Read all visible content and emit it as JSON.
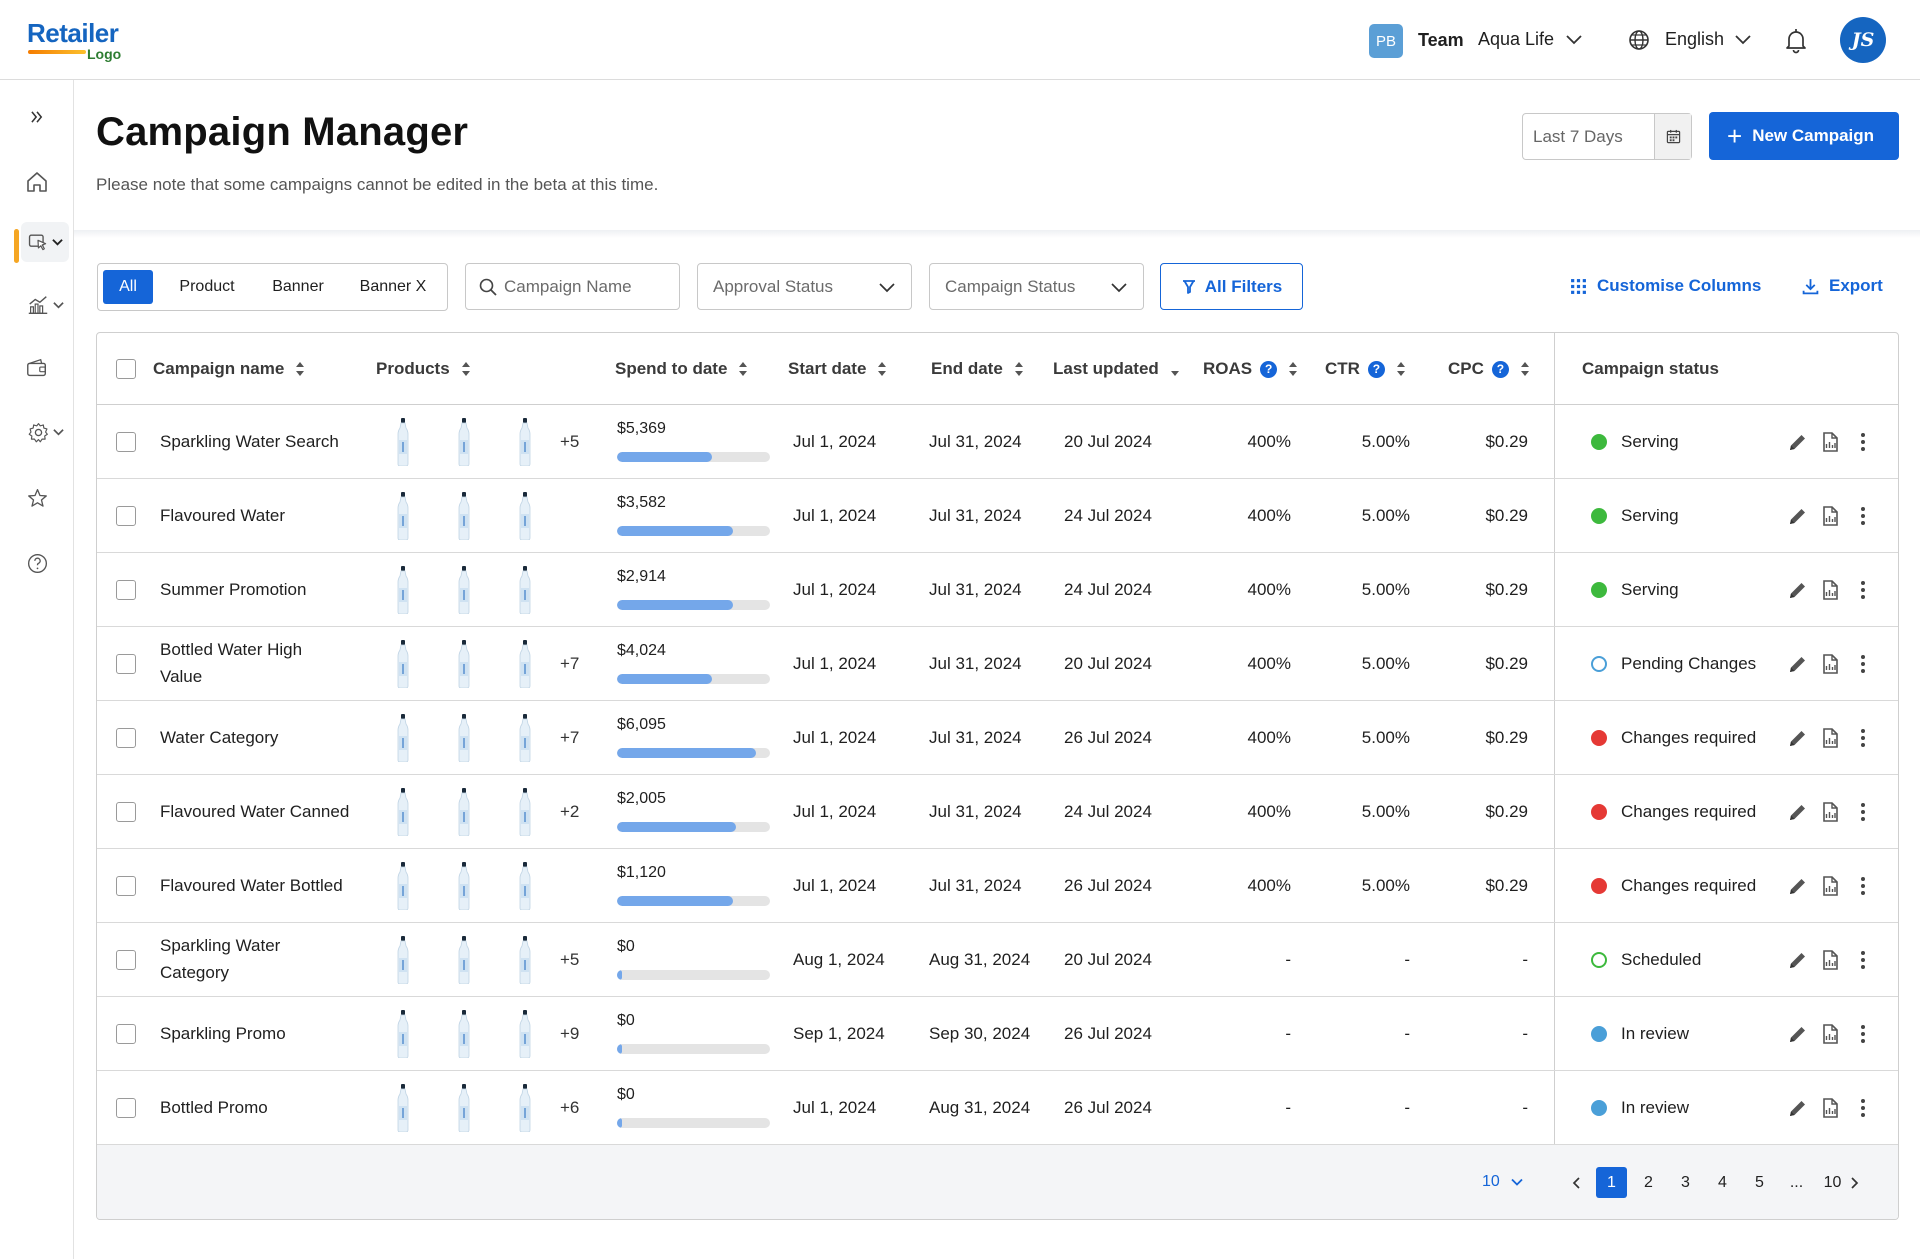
{
  "header": {
    "logo_top": "Retailer",
    "logo_bottom": "Logo",
    "team_initials": "PB",
    "team_label": "Team",
    "team_name": "Aqua Life",
    "language": "English",
    "user_initials": "JS"
  },
  "page": {
    "title": "Campaign Manager",
    "note": "Please note that some campaigns cannot be edited in the beta at this time.",
    "date_range": "Last 7 Days",
    "new_campaign": "New Campaign"
  },
  "filters": {
    "types": [
      "All",
      "Product",
      "Banner",
      "Banner X"
    ],
    "active_type": "All",
    "search_placeholder": "Campaign Name",
    "approval_status": "Approval Status",
    "campaign_status": "Campaign Status",
    "all_filters": "All Filters",
    "customise_columns": "Customise Columns",
    "export": "Export"
  },
  "columns": {
    "name": "Campaign name",
    "products": "Products",
    "spend": "Spend to date",
    "start": "Start date",
    "end": "End date",
    "updated": "Last updated",
    "roas": "ROAS",
    "ctr": "CTR",
    "cpc": "CPC",
    "status": "Campaign status"
  },
  "status_colors": {
    "serving": "#3db93d",
    "pending": "#4a9fd8",
    "changes": "#e53935",
    "scheduled": "#3db93d",
    "review": "#4a9fd8"
  },
  "rows": [
    {
      "name": "Sparkling Water Search",
      "more": "+5",
      "spend": "$5,369",
      "spend_pct": 0.62,
      "start": "Jul 1, 2024",
      "end": "Jul 31, 2024",
      "updated": "20 Jul 2024",
      "roas": "400%",
      "ctr": "5.00%",
      "cpc": "$0.29",
      "status": "Serving",
      "status_kind": "serving"
    },
    {
      "name": "Flavoured Water",
      "more": "",
      "spend": "$3,582",
      "spend_pct": 0.76,
      "start": "Jul 1, 2024",
      "end": "Jul 31, 2024",
      "updated": "24 Jul 2024",
      "roas": "400%",
      "ctr": "5.00%",
      "cpc": "$0.29",
      "status": "Serving",
      "status_kind": "serving"
    },
    {
      "name": "Summer Promotion",
      "more": "",
      "spend": "$2,914",
      "spend_pct": 0.76,
      "start": "Jul 1, 2024",
      "end": "Jul 31, 2024",
      "updated": "24 Jul 2024",
      "roas": "400%",
      "ctr": "5.00%",
      "cpc": "$0.29",
      "status": "Serving",
      "status_kind": "serving"
    },
    {
      "name": "Bottled Water High Value",
      "more": "+7",
      "spend": "$4,024",
      "spend_pct": 0.62,
      "start": "Jul 1, 2024",
      "end": "Jul 31, 2024",
      "updated": "20 Jul 2024",
      "roas": "400%",
      "ctr": "5.00%",
      "cpc": "$0.29",
      "status": "Pending Changes",
      "status_kind": "pending"
    },
    {
      "name": "Water Category",
      "more": "+7",
      "spend": "$6,095",
      "spend_pct": 0.91,
      "start": "Jul 1, 2024",
      "end": "Jul 31, 2024",
      "updated": "26 Jul 2024",
      "roas": "400%",
      "ctr": "5.00%",
      "cpc": "$0.29",
      "status": "Changes required",
      "status_kind": "changes"
    },
    {
      "name": "Flavoured Water Canned",
      "more": "+2",
      "spend": "$2,005",
      "spend_pct": 0.78,
      "start": "Jul 1, 2024",
      "end": "Jul 31, 2024",
      "updated": "24 Jul 2024",
      "roas": "400%",
      "ctr": "5.00%",
      "cpc": "$0.29",
      "status": "Changes required",
      "status_kind": "changes"
    },
    {
      "name": "Flavoured Water Bottled",
      "more": "",
      "spend": "$1,120",
      "spend_pct": 0.76,
      "start": "Jul 1, 2024",
      "end": "Jul 31, 2024",
      "updated": "26 Jul 2024",
      "roas": "400%",
      "ctr": "5.00%",
      "cpc": "$0.29",
      "status": "Changes required",
      "status_kind": "changes"
    },
    {
      "name": "Sparkling Water Category",
      "more": "+5",
      "spend": "$0",
      "spend_pct": 0.02,
      "start": "Aug 1, 2024",
      "end": "Aug 31, 2024",
      "updated": "20 Jul 2024",
      "roas": "-",
      "ctr": "-",
      "cpc": "-",
      "status": "Scheduled",
      "status_kind": "scheduled"
    },
    {
      "name": "Sparkling Promo",
      "more": "+9",
      "spend": "$0",
      "spend_pct": 0.02,
      "start": "Sep 1, 2024",
      "end": "Sep 30, 2024",
      "updated": "26 Jul 2024",
      "roas": "-",
      "ctr": "-",
      "cpc": "-",
      "status": "In review",
      "status_kind": "review"
    },
    {
      "name": "Bottled Promo",
      "more": "+6",
      "spend": "$0",
      "spend_pct": 0.02,
      "start": "Jul 1, 2024",
      "end": "Aug 31, 2024",
      "updated": "26 Jul 2024",
      "roas": "-",
      "ctr": "-",
      "cpc": "-",
      "status": "In review",
      "status_kind": "review"
    }
  ],
  "pagination": {
    "per_page": "10",
    "pages": [
      "1",
      "2",
      "3",
      "4",
      "5",
      "...",
      "10"
    ],
    "current": "1"
  }
}
